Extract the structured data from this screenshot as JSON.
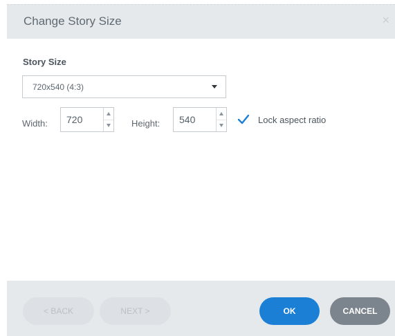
{
  "dialog": {
    "title": "Change Story Size",
    "close_glyph": "×"
  },
  "story_size": {
    "label": "Story Size",
    "selected": "720x540 (4:3)"
  },
  "width": {
    "label": "Width:",
    "value": "720"
  },
  "height": {
    "label": "Height:",
    "value": "540"
  },
  "lock_aspect": {
    "label": "Lock aspect ratio",
    "checked": true
  },
  "footer": {
    "back_label": "< BACK",
    "next_label": "NEXT >",
    "ok_label": "OK",
    "cancel_label": "CANCEL"
  },
  "colors": {
    "primary": "#1b7fd6",
    "cancel": "#7c858d",
    "disabled": "#dde1e5",
    "checkmark": "#1b7fd6"
  },
  "icons": {
    "close": "close-icon",
    "dropdown": "chevron-down-icon",
    "spin_up": "caret-up-icon",
    "spin_down": "caret-down-icon",
    "check": "checkmark-icon"
  }
}
